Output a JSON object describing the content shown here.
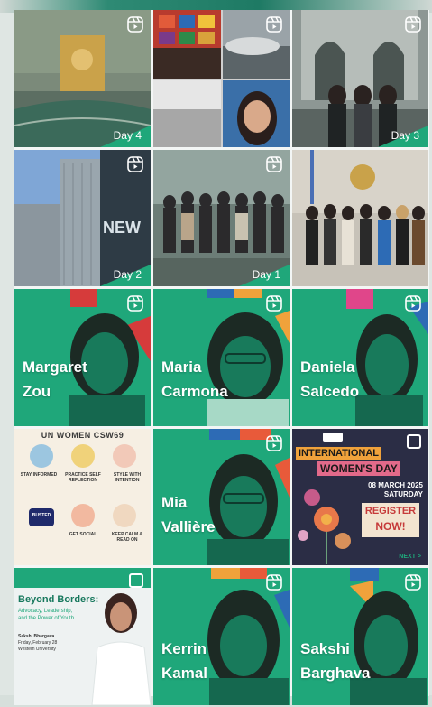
{
  "tiles": [
    {
      "label": "Day 4"
    },
    {
      "label": ""
    },
    {
      "label": "Day 3"
    },
    {
      "label": "Day 2"
    },
    {
      "label": "Day 1"
    },
    {
      "label": ""
    },
    {
      "line1": "Margaret",
      "line2": "Zou"
    },
    {
      "line1": "Maria",
      "line2": "Carmona"
    },
    {
      "line1": "Daniela",
      "line2": "Salcedo"
    },
    {
      "header": "UN WOMEN CSW69",
      "cells": [
        "STAY INFORMED",
        "PRACTICE SELF REFLECTION",
        "STYLE WITH INTENTION",
        "BUSTED",
        "GET SOCIAL",
        "KEEP CALM & READ ON"
      ]
    },
    {
      "line1": "Mia",
      "line2": "Vallière"
    },
    {
      "line1": "INTERNATIONAL",
      "line2": "WOMEN'S DAY",
      "date": "08 MARCH 2025",
      "day": "SATURDAY",
      "cta1": "REGISTER",
      "cta2": "NOW!",
      "next": "NEXT >"
    },
    {
      "title": "Beyond Borders:",
      "subtitle1": "Advocacy, Leadership,",
      "subtitle2": "and the Power of Youth",
      "speaker": "Sakshi Bhargava",
      "date": "Friday, February 28",
      "venue": "Western University"
    },
    {
      "line1": "Kerrin",
      "line2": "Kamal"
    },
    {
      "line1": "Sakshi",
      "line2": "Barghava"
    }
  ],
  "colors": {
    "brand_green": "#1fa77a",
    "dark_green": "#17785d",
    "accent_orange": "#f0a23b",
    "accent_red": "#d63b3b",
    "accent_blue": "#2d6bb5"
  },
  "icons": {
    "reel": "reel-icon"
  }
}
